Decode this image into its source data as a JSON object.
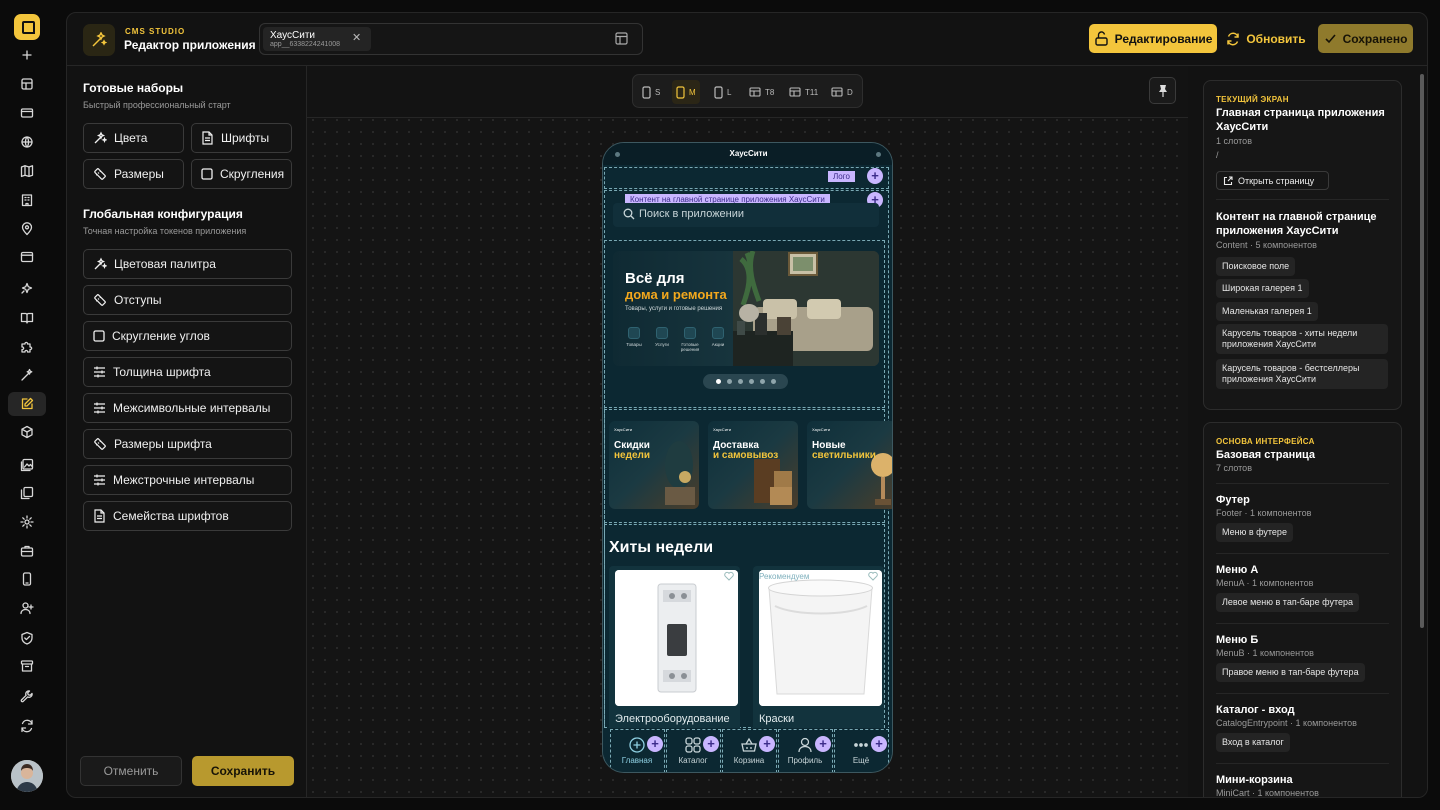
{
  "header": {
    "brand_small": "CMS STUDIO",
    "brand_title": "Редактор приложения",
    "app_tab": {
      "name": "ХаусСити",
      "id": "app__6338224241008"
    },
    "edit_label": "Редактирование",
    "refresh_label": "Обновить",
    "saved_label": "Сохранено",
    "accent": "#f3c53c"
  },
  "rail": {
    "icons": [
      "plus-icon",
      "layout-icon",
      "card-icon",
      "globe-icon",
      "map-icon",
      "building-icon",
      "pin-icon",
      "browser-icon",
      "sparkle-icon",
      "book-icon",
      "puzzle-icon",
      "wand-icon",
      "edit-icon",
      "cube-icon",
      "image-icon",
      "copy-icon",
      "settings-icon",
      "briefcase-icon",
      "phone-icon",
      "user-plus-icon",
      "shield-icon",
      "archive-icon",
      "wrench-icon",
      "sync-icon"
    ]
  },
  "left": {
    "presets_title": "Готовые наборы",
    "presets_sub": "Быстрый профессиональный старт",
    "presets": [
      {
        "label": "Цвета",
        "icon": "palette-icon"
      },
      {
        "label": "Шрифты",
        "icon": "file-icon"
      },
      {
        "label": "Размеры",
        "icon": "ruler-icon"
      },
      {
        "label": "Скругления",
        "icon": "square-icon"
      }
    ],
    "global_title": "Глобальная конфигурация",
    "global_sub": "Точная настройка токенов приложения",
    "global": [
      {
        "label": "Цветовая палитра",
        "icon": "palette-icon"
      },
      {
        "label": "Отступы",
        "icon": "ruler-icon"
      },
      {
        "label": "Скругление углов",
        "icon": "square-icon"
      },
      {
        "label": "Толщина шрифта",
        "icon": "sliders-icon"
      },
      {
        "label": "Межсимвольные интервалы",
        "icon": "sliders-icon"
      },
      {
        "label": "Размеры шрифта",
        "icon": "ruler-icon"
      },
      {
        "label": "Межстрочные интервалы",
        "icon": "sliders-icon"
      },
      {
        "label": "Семейства шрифтов",
        "icon": "file-icon"
      }
    ],
    "cancel": "Отменить",
    "save": "Сохранить"
  },
  "canvas": {
    "breakpoints": [
      "S",
      "M",
      "L",
      "T8",
      "T11",
      "D"
    ],
    "active_breakpoint": "M"
  },
  "phone": {
    "title": "ХаусСити",
    "logo_tag": "Лого",
    "content_tag": "Контент на главной странице приложения ХаусСити",
    "search_placeholder": "Поиск в приложении",
    "banner": {
      "line1": "Всё для",
      "line2": "дома и ремонта",
      "sub": "Товары, услуги и готовые решения",
      "icons": [
        "Товары",
        "Услуги",
        "Готовые решения",
        "Акции"
      ]
    },
    "carousel_dots": 6,
    "small_banners": [
      {
        "brand": "ХаусСити",
        "l1": "Скидки",
        "l2": "недели"
      },
      {
        "brand": "ХаусСити",
        "l1": "Доставка",
        "l2": "и самовывоз"
      },
      {
        "brand": "ХаусСити",
        "l1": "Новые",
        "l2": "светильники"
      }
    ],
    "hits_title": "Хиты недели",
    "products": [
      {
        "caption": "Электрооборудование",
        "badge": ""
      },
      {
        "caption": "Краски",
        "badge": "Рекомендуем"
      }
    ],
    "tabbar": [
      {
        "label": "Главная",
        "icon": "home-plus-icon"
      },
      {
        "label": "Каталог",
        "icon": "grid-icon"
      },
      {
        "label": "Корзина",
        "icon": "basket-icon"
      },
      {
        "label": "Профиль",
        "icon": "user-icon"
      },
      {
        "label": "Ещё",
        "icon": "more-icon"
      }
    ]
  },
  "right": {
    "screen": {
      "kicker": "ТЕКУЩИЙ ЭКРАН",
      "title": "Главная страница приложения ХаусСити",
      "slots": "1 слотов",
      "path": "/",
      "open_btn": "Открыть страницу",
      "content_title": "Контент на главной странице приложения ХаусСити",
      "content_meta": "Content · 5 компонентов",
      "components": [
        "Поисковое поле",
        "Широкая галерея 1",
        "Маленькая галерея 1",
        "Карусель товаров - хиты недели приложения ХаусСити",
        "Карусель товаров - бестселлеры приложения ХаусСити"
      ]
    },
    "base": {
      "kicker": "ОСНОВА ИНТЕРФЕЙСА",
      "title": "Базовая страница",
      "slots": "7 слотов",
      "items": [
        {
          "title": "Футер",
          "meta": "Footer · 1 компонентов",
          "pill": "Меню в футере"
        },
        {
          "title": "Меню А",
          "meta": "MenuA · 1 компонентов",
          "pill": "Левое меню в тап-баре футера"
        },
        {
          "title": "Меню Б",
          "meta": "MenuB · 1 компонентов",
          "pill": "Правое меню в тап-баре футера"
        },
        {
          "title": "Каталог - вход",
          "meta": "CatalogEntrypoint · 1 компонентов",
          "pill": "Вход в каталог"
        },
        {
          "title": "Мини-корзина",
          "meta": "MiniCart · 1 компонентов",
          "pill": ""
        }
      ]
    }
  }
}
